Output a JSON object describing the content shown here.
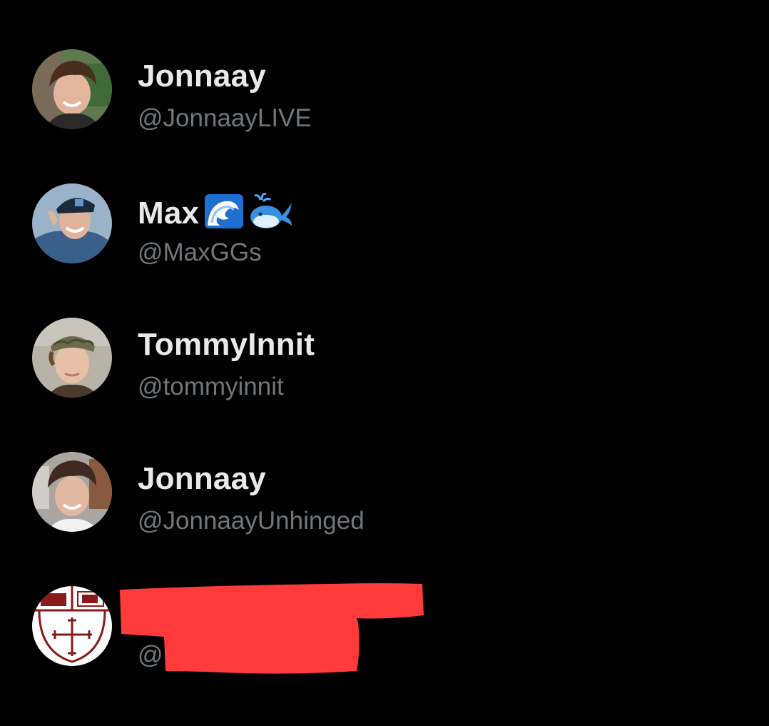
{
  "accounts": [
    {
      "display_name": "Jonnaay",
      "handle": "@JonnaayLIVE"
    },
    {
      "display_name": "Max",
      "emojis": [
        "water-wave-emoji",
        "spouting-whale-emoji"
      ],
      "handle": "@MaxGGs"
    },
    {
      "display_name": "TommyInnit",
      "handle": "@tommyinnit"
    },
    {
      "display_name": "Jonnaay",
      "handle": "@JonnaayUnhinged"
    },
    {
      "display_name": "",
      "handle": "@",
      "redacted": true
    }
  ],
  "colors": {
    "background": "#000000",
    "name_text": "#e7e9ea",
    "handle_text": "#71767b",
    "redaction": "#ff3a3a"
  }
}
